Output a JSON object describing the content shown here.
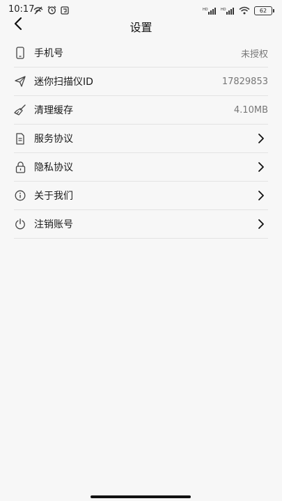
{
  "status_bar": {
    "time": "10:17",
    "battery": "62"
  },
  "header": {
    "title": "设置"
  },
  "settings": {
    "items": [
      {
        "label": "手机号",
        "value": "未授权",
        "icon": "phone-icon"
      },
      {
        "label": "迷你扫描仪ID",
        "value": "17829853",
        "icon": "send-icon"
      },
      {
        "label": "清理缓存",
        "value": "4.10MB",
        "icon": "broom-icon"
      },
      {
        "label": "服务协议",
        "value": "",
        "icon": "document-icon"
      },
      {
        "label": "隐私协议",
        "value": "",
        "icon": "lock-icon"
      },
      {
        "label": "关于我们",
        "value": "",
        "icon": "info-icon"
      },
      {
        "label": "注销账号",
        "value": "",
        "icon": "power-icon"
      }
    ]
  }
}
